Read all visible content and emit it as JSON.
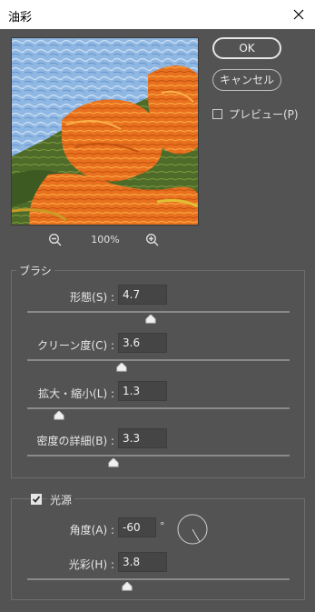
{
  "window": {
    "title": "油彩"
  },
  "preview": {
    "zoom": "100%"
  },
  "buttons": {
    "ok": "OK",
    "cancel": "キャンセル"
  },
  "preview_toggle": {
    "label": "プレビュー(P)",
    "checked": false
  },
  "brush": {
    "legend": "ブラシ",
    "sliders": [
      {
        "label": "形態(S) :",
        "value": "4.7",
        "fraction": 0.47
      },
      {
        "label": "クリーン度(C) :",
        "value": "3.6",
        "fraction": 0.36
      },
      {
        "label": "拡大・縮小(L) :",
        "value": "1.3",
        "fraction": 0.12
      },
      {
        "label": "密度の詳細(B) :",
        "value": "3.3",
        "fraction": 0.33
      }
    ]
  },
  "lighting": {
    "label": "光源",
    "enabled": true,
    "angle_label": "角度(A) :",
    "angle": "-60",
    "degree_symbol": "°",
    "shine_label": "光彩(H) :",
    "shine": "3.8",
    "shine_fraction": 0.38
  },
  "colors": {
    "background": "#535353",
    "titlebar": "#ffffff",
    "accent": "#e6e6e6"
  }
}
